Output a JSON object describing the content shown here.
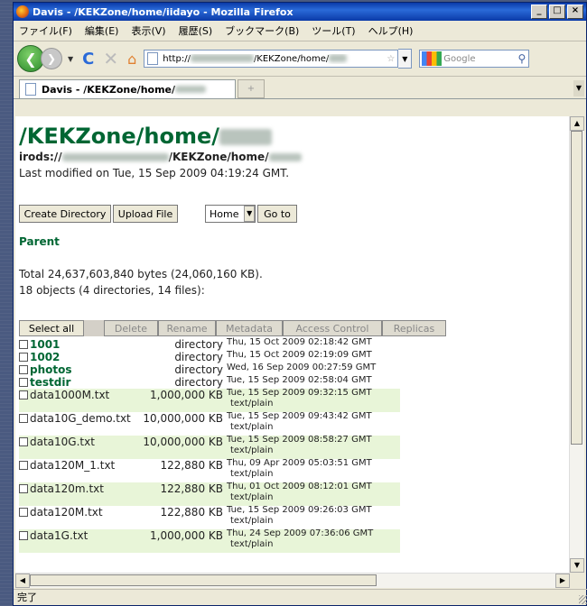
{
  "window": {
    "title": "Davis - /KEKZone/home/iidayo - Mozilla Firefox"
  },
  "menu": [
    "ファイル(F)",
    "編集(E)",
    "表示(V)",
    "履歴(S)",
    "ブックマーク(B)",
    "ツール(T)",
    "ヘルプ(H)"
  ],
  "nav": {
    "url_start": "http://",
    "url_end": "/KEKZone/home/",
    "search_placeholder": "Google"
  },
  "tab": {
    "title": "Davis - /KEKZone/home/"
  },
  "page": {
    "heading": "/KEKZone/home/",
    "irods_prefix": "irods://",
    "irods_path": "/KEKZone/home/",
    "last_modified": "Last modified on Tue, 15 Sep 2009 04:19:24 GMT.",
    "create_dir": "Create Directory",
    "upload_file": "Upload File",
    "select_value": "Home",
    "go_to": "Go to",
    "parent": "Parent",
    "total": "Total 24,637,603,840 bytes (24,060,160 KB).",
    "objects": "18 objects (4 directories, 14 files):",
    "actions": [
      "Select all",
      "Delete",
      "Rename",
      "Metadata",
      "Access Control",
      "Replicas"
    ]
  },
  "directories": [
    {
      "name": "1001",
      "type": "directory",
      "date": "Thu, 15 Oct 2009 02:18:42 GMT"
    },
    {
      "name": "1002",
      "type": "directory",
      "date": "Thu, 15 Oct 2009 02:19:09 GMT"
    },
    {
      "name": "photos",
      "type": "directory",
      "date": "Wed, 16 Sep 2009 00:27:59 GMT"
    },
    {
      "name": "testdir",
      "type": "directory",
      "date": "Tue, 15 Sep 2009 02:58:04 GMT"
    }
  ],
  "files": [
    {
      "name": "data1000M.txt",
      "size": "1,000,000 KB",
      "date": "Tue, 15 Sep 2009 09:32:15 GMT",
      "mime": "text/plain"
    },
    {
      "name": "data10G_demo.txt",
      "size": "10,000,000 KB",
      "date": "Tue, 15 Sep 2009 09:43:42 GMT",
      "mime": "text/plain"
    },
    {
      "name": "data10G.txt",
      "size": "10,000,000 KB",
      "date": "Tue, 15 Sep 2009 08:58:27 GMT",
      "mime": "text/plain"
    },
    {
      "name": "data120M_1.txt",
      "size": "122,880 KB",
      "date": "Thu, 09 Apr 2009 05:03:51 GMT",
      "mime": "text/plain"
    },
    {
      "name": "data120m.txt",
      "size": "122,880 KB",
      "date": "Thu, 01 Oct 2009 08:12:01 GMT",
      "mime": "text/plain"
    },
    {
      "name": "data120M.txt",
      "size": "122,880 KB",
      "date": "Tue, 15 Sep 2009 09:26:03 GMT",
      "mime": "text/plain"
    },
    {
      "name": "data1G.txt",
      "size": "1,000,000 KB",
      "date": "Thu, 24 Sep 2009 07:36:06 GMT",
      "mime": "text/plain"
    }
  ],
  "status": "完了"
}
